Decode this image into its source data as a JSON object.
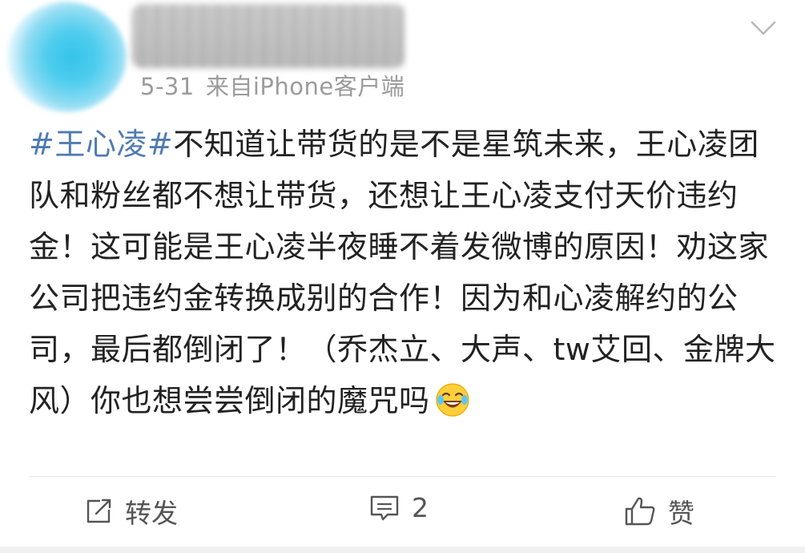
{
  "post": {
    "date": "5-31",
    "source": "来自iPhone客户端",
    "hashtag": "#王心凌#",
    "body": "不知道让带货的是不是星筑未来，王心凌团队和粉丝都不想让带货，还想让王心凌支付天价违约金！这可能是王心凌半夜睡不着发微博的原因！劝这家公司把违约金转换成别的合作！因为和心凌解约的公司，最后都倒闭了！（乔杰立、大声、tw艾回、金牌大风）你也想尝尝倒闭的魔咒吗",
    "emoji": "laughing-crying-emoji"
  },
  "actions": {
    "repost_label": "转发",
    "comment_count": "2",
    "like_label": "赞"
  },
  "colors": {
    "hashtag": "#4f7bb0",
    "text": "#222222",
    "meta": "#9b9b9b"
  }
}
